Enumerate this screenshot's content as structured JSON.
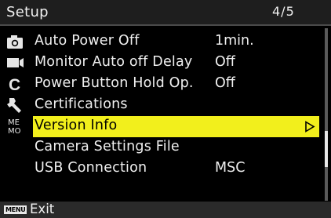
{
  "header": {
    "title": "Setup",
    "page": "4/5"
  },
  "tabs": [
    {
      "icon": "camera-icon",
      "selected": false
    },
    {
      "icon": "video-camera-icon",
      "selected": false
    },
    {
      "icon": "custom-c-icon",
      "label": "C",
      "selected": false
    },
    {
      "icon": "wrench-icon",
      "selected": true
    },
    {
      "icon": "my-menu-icon",
      "label": "ME\nMO",
      "selected": false
    }
  ],
  "menu": {
    "items": [
      {
        "label": "Auto Power Off",
        "value": "1min."
      },
      {
        "label": "Monitor Auto off Delay",
        "value": "Off"
      },
      {
        "label": "Power Button Hold Op.",
        "value": "Off"
      },
      {
        "label": "Certifications",
        "value": ""
      },
      {
        "label": "Version Info",
        "value": "",
        "selected": true,
        "has_submenu": true
      },
      {
        "label": "Camera Settings File",
        "value": ""
      },
      {
        "label": "USB Connection",
        "value": "MSC"
      }
    ]
  },
  "scrollbar": {
    "page": 4,
    "pages": 5
  },
  "footer": {
    "key_label": "MENU",
    "action": "Exit"
  },
  "colors": {
    "highlight": "#f2ef1c",
    "background": "#000000",
    "header": "#1e1e1e"
  }
}
